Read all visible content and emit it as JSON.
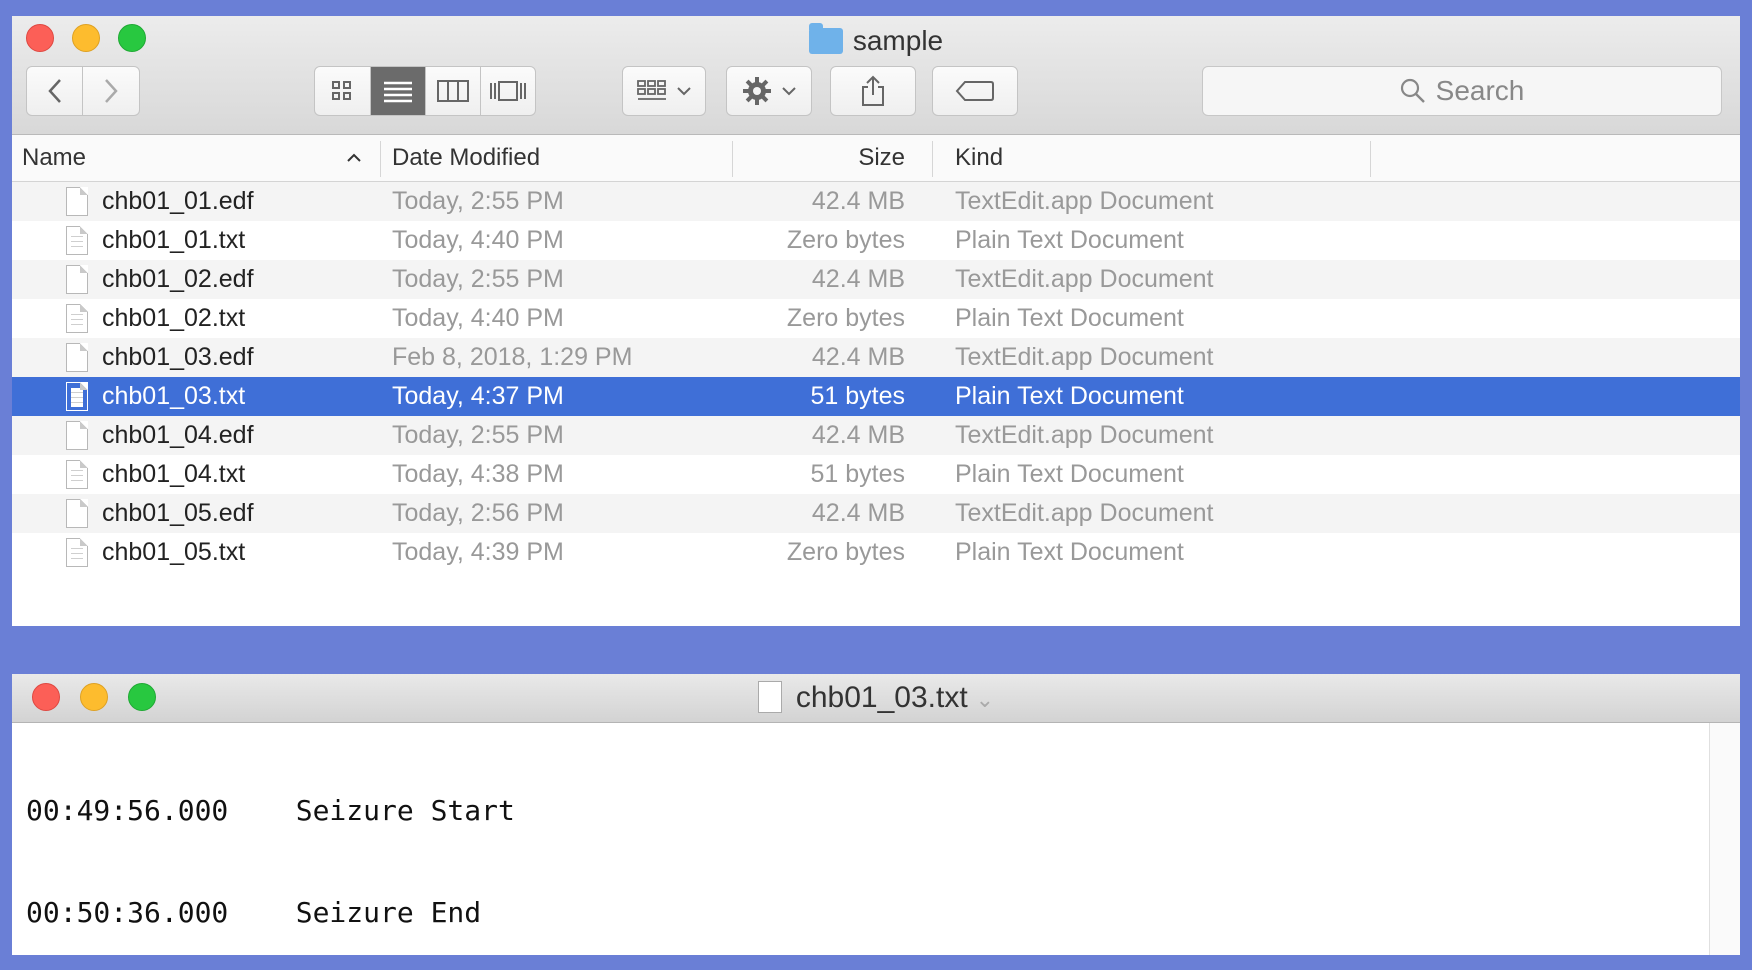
{
  "finder": {
    "title": "sample",
    "search_placeholder": "Search",
    "columns": {
      "name": "Name",
      "date": "Date Modified",
      "size": "Size",
      "kind": "Kind"
    },
    "sort_indicator": "^",
    "files": [
      {
        "name": "chb01_01.edf",
        "date": "Today, 2:55 PM",
        "size": "42.4 MB",
        "kind": "TextEdit.app Document",
        "type": "edf"
      },
      {
        "name": "chb01_01.txt",
        "date": "Today, 4:40 PM",
        "size": "Zero bytes",
        "kind": "Plain Text Document",
        "type": "txt"
      },
      {
        "name": "chb01_02.edf",
        "date": "Today, 2:55 PM",
        "size": "42.4 MB",
        "kind": "TextEdit.app Document",
        "type": "edf"
      },
      {
        "name": "chb01_02.txt",
        "date": "Today, 4:40 PM",
        "size": "Zero bytes",
        "kind": "Plain Text Document",
        "type": "txt"
      },
      {
        "name": "chb01_03.edf",
        "date": "Feb 8, 2018, 1:29 PM",
        "size": "42.4 MB",
        "kind": "TextEdit.app Document",
        "type": "edf"
      },
      {
        "name": "chb01_03.txt",
        "date": "Today, 4:37 PM",
        "size": "51 bytes",
        "kind": "Plain Text Document",
        "type": "txt",
        "selected": true
      },
      {
        "name": "chb01_04.edf",
        "date": "Today, 2:55 PM",
        "size": "42.4 MB",
        "kind": "TextEdit.app Document",
        "type": "edf"
      },
      {
        "name": "chb01_04.txt",
        "date": "Today, 4:38 PM",
        "size": "51 bytes",
        "kind": "Plain Text Document",
        "type": "txt"
      },
      {
        "name": "chb01_05.edf",
        "date": "Today, 2:56 PM",
        "size": "42.4 MB",
        "kind": "TextEdit.app Document",
        "type": "edf"
      },
      {
        "name": "chb01_05.txt",
        "date": "Today, 4:39 PM",
        "size": "Zero bytes",
        "kind": "Plain Text Document",
        "type": "txt"
      }
    ],
    "selection_color": "#3f6fd7"
  },
  "editor": {
    "title": "chb01_03.txt",
    "lines": [
      "00:49:56.000    Seizure Start",
      "00:50:36.000    Seizure End"
    ]
  },
  "icons": [
    "close-button",
    "minimize-button",
    "zoom-button",
    "back-icon",
    "forward-icon",
    "icon-view-icon",
    "list-view-icon",
    "column-view-icon",
    "cover-flow-icon",
    "arrange-icon",
    "gear-icon",
    "share-icon",
    "tag-icon",
    "search-icon",
    "folder-icon",
    "file-icon"
  ]
}
